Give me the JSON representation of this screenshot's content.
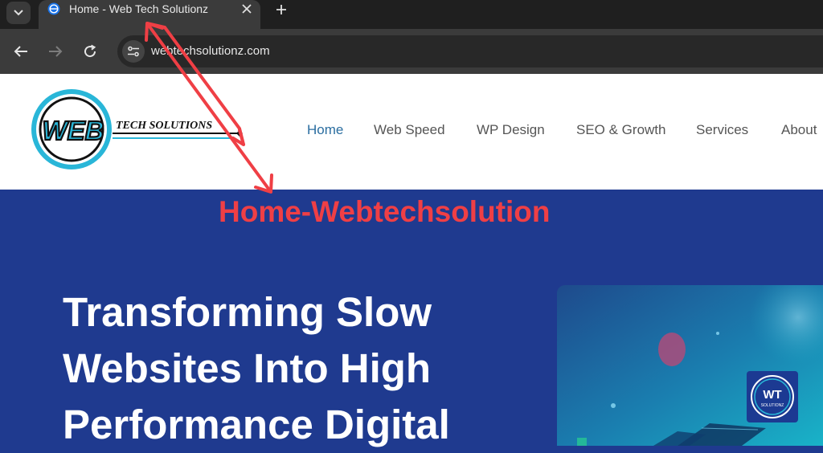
{
  "browser": {
    "tab": {
      "title": "Home - Web Tech Solutionz"
    },
    "address_bar": {
      "url": "webtechsolutionz.com"
    }
  },
  "site": {
    "logo": {
      "word": "WEB",
      "tagline": "TECH SOLUTIONS"
    },
    "nav": [
      {
        "label": "Home",
        "active": true
      },
      {
        "label": "Web Speed",
        "active": false
      },
      {
        "label": "WP Design",
        "active": false
      },
      {
        "label": "SEO & Growth",
        "active": false
      },
      {
        "label": "Services",
        "active": false
      },
      {
        "label": "About",
        "active": false
      }
    ]
  },
  "annotation": {
    "label": "Home-Webtechsolution",
    "color": "#ef3f45"
  },
  "hero": {
    "title_lines": [
      "Transforming Slow",
      "Websites Into High",
      "Performance Digital"
    ],
    "badge": {
      "initials": "WT",
      "subtext": "SOLUTIONZ"
    }
  },
  "colors": {
    "hero_bg": "#1f3a8f",
    "nav_active": "#2b6ea0",
    "nav_text": "#555555",
    "logo_cyan": "#29b6d8"
  },
  "icons": {
    "tab_list": "chevron-down-icon",
    "favicon": "globe-icon",
    "tab_close": "close-icon",
    "new_tab": "plus-icon",
    "back": "arrow-left-icon",
    "forward": "arrow-right-icon",
    "reload": "reload-icon",
    "site_info": "tune-icon"
  }
}
